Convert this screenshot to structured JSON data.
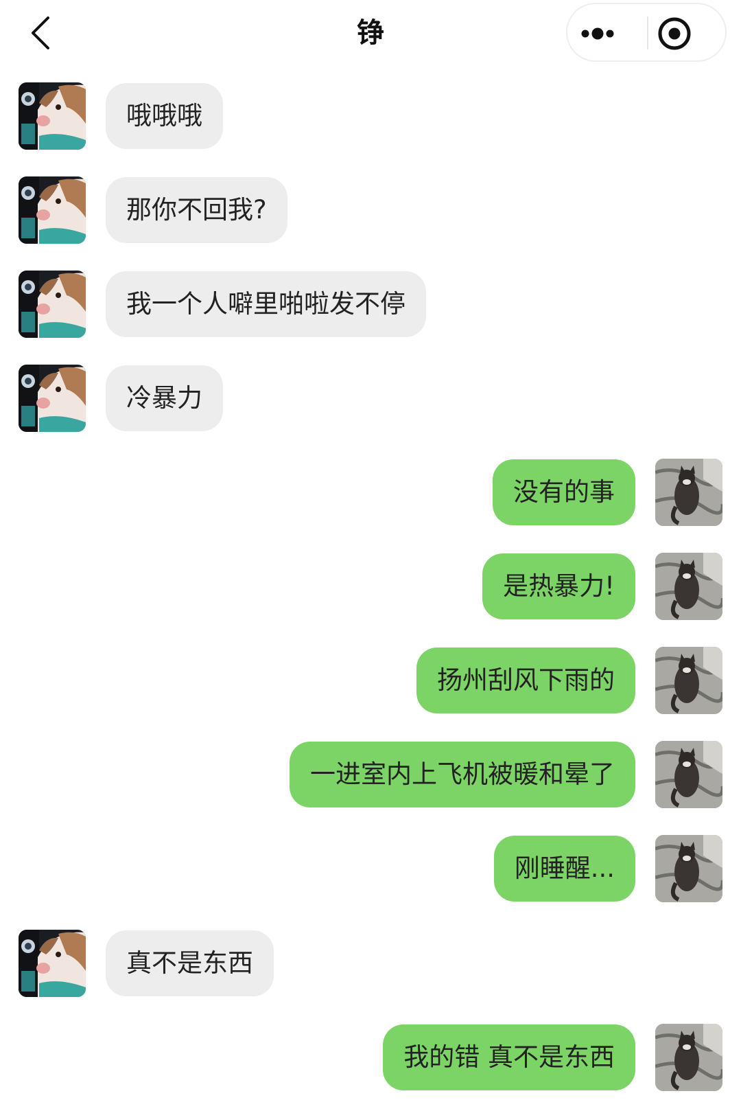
{
  "header": {
    "title": "铮"
  },
  "icons": {
    "back": "chevron-left-icon",
    "more": "more-dots-icon",
    "close": "target-circle-icon"
  },
  "colors": {
    "incoming_bubble": "#ededed",
    "outgoing_bubble": "#7dd466",
    "background": "#ffffff"
  },
  "messages": [
    {
      "side": "left",
      "text": "哦哦哦"
    },
    {
      "side": "left",
      "text": "那你不回我?"
    },
    {
      "side": "left",
      "text": "我一个人噼里啪啦发不停"
    },
    {
      "side": "left",
      "text": "冷暴力"
    },
    {
      "side": "right",
      "text": "没有的事"
    },
    {
      "side": "right",
      "text": "是热暴力!"
    },
    {
      "side": "right",
      "text": "扬州刮风下雨的"
    },
    {
      "side": "right",
      "text": "一进室内上飞机被暖和晕了"
    },
    {
      "side": "right",
      "text": "刚睡醒..."
    },
    {
      "side": "left",
      "text": "真不是东西"
    },
    {
      "side": "right",
      "text": "我的错 真不是东西"
    }
  ]
}
